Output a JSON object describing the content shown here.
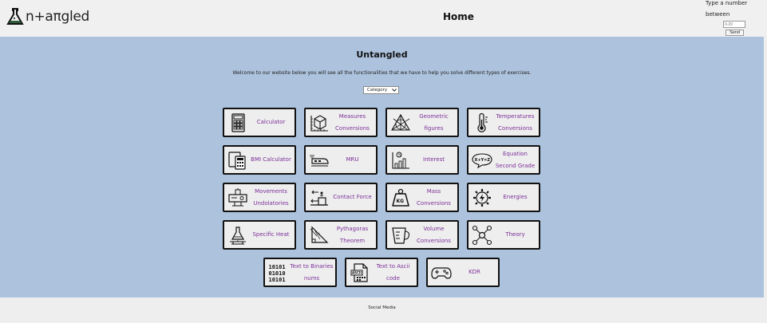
{
  "header": {
    "logo_text": "n+aπgled",
    "nav_home": "Home",
    "number_prompt_line1": "Type a number",
    "number_prompt_line2": "between",
    "number_placeholder": "0-20",
    "send_label": "Send"
  },
  "main": {
    "title": "Untangled",
    "welcome": "Welcome to our website below you will see all the functionalities that we have to help you solve different types of exercises.",
    "category_select": "Category"
  },
  "tools": [
    {
      "label": "Calculator",
      "icon": "calculator-icon"
    },
    {
      "label": "Measures Conversions",
      "icon": "measures-cube-icon"
    },
    {
      "label": "Geometric figures",
      "icon": "geometric-figures-icon"
    },
    {
      "label": "Temperatures Conversions",
      "icon": "thermometer-icon"
    },
    {
      "label": "BMI Calculator",
      "icon": "bmi-calculator-icon"
    },
    {
      "label": "MRU",
      "icon": "train-icon"
    },
    {
      "label": "Interest",
      "icon": "interest-chart-icon"
    },
    {
      "label": "Equation Second Grade",
      "icon": "equation-bubble-icon"
    },
    {
      "label": "Movements Undolatories",
      "icon": "oscillator-icon"
    },
    {
      "label": "Contact Force",
      "icon": "force-icon"
    },
    {
      "label": "Mass Conversions",
      "icon": "kg-weight-icon"
    },
    {
      "label": "Energies",
      "icon": "energy-gear-icon"
    },
    {
      "label": "Specific Heat",
      "icon": "heating-flask-icon"
    },
    {
      "label": "Pythagoras Theorem",
      "icon": "triangle-icon"
    },
    {
      "label": "Volume Conversions",
      "icon": "measuring-cup-icon"
    },
    {
      "label": "Theory",
      "icon": "molecule-icon"
    },
    {
      "label": "Text to Binaries nums",
      "icon": "binary-icon"
    },
    {
      "label": "Text to Ascii code",
      "icon": "ascii-file-icon"
    },
    {
      "label": "KDR",
      "icon": "gamepad-icon"
    }
  ],
  "footer": {
    "social_media": "Social Media"
  }
}
